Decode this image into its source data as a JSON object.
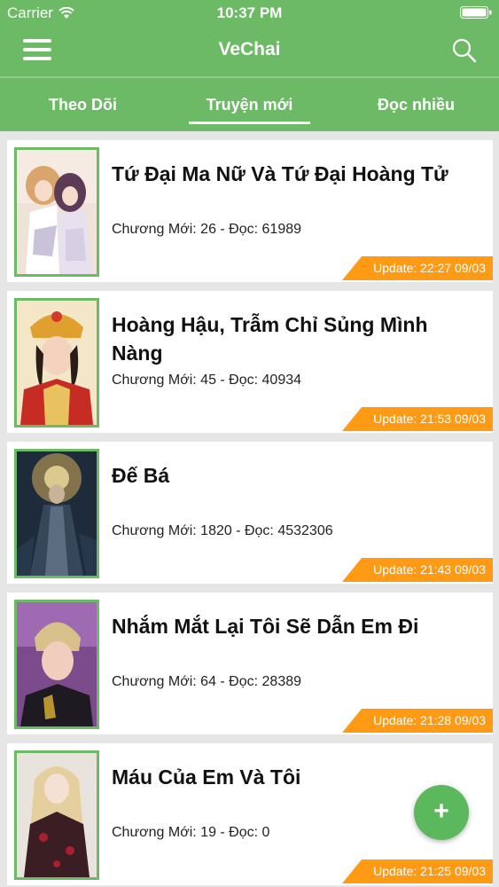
{
  "status_bar": {
    "carrier": "Carrier",
    "time": "10:37 PM"
  },
  "nav": {
    "title": "VeChai",
    "menu_icon": "hamburger-icon",
    "search_icon": "search-icon"
  },
  "tabs": [
    {
      "label": "Theo Dõi",
      "active": false
    },
    {
      "label": "Truyện mới",
      "active": true
    },
    {
      "label": "Đọc nhiều",
      "active": false
    }
  ],
  "stories": [
    {
      "title": "Tứ Đại Ma Nữ Và Tứ Đại Hoàng Tử",
      "meta": "Chương Mới: 26 - Đọc: 61989",
      "update": "Update: 22:27 09/03"
    },
    {
      "title": "Hoàng Hậu, Trẫm Chỉ Sủng Mình Nàng",
      "meta": "Chương Mới: 45 - Đọc: 40934",
      "update": "Update: 21:53 09/03"
    },
    {
      "title": "Đế Bá",
      "meta": "Chương Mới: 1820 - Đọc: 4532306",
      "update": "Update: 21:43 09/03"
    },
    {
      "title": "Nhắm Mắt Lại Tôi Sẽ Dẫn Em Đi",
      "meta": "Chương Mới: 64 - Đọc: 28389",
      "update": "Update: 21:28 09/03"
    },
    {
      "title": "Máu Của Em Và Tôi",
      "meta": "Chương Mới: 19 - Đọc: 0",
      "update": "Update: 21:25 09/03"
    }
  ],
  "fab": {
    "label": "+"
  },
  "colors": {
    "primary": "#6cb966",
    "accent": "#ff9a14",
    "fab": "#5cb85c"
  }
}
